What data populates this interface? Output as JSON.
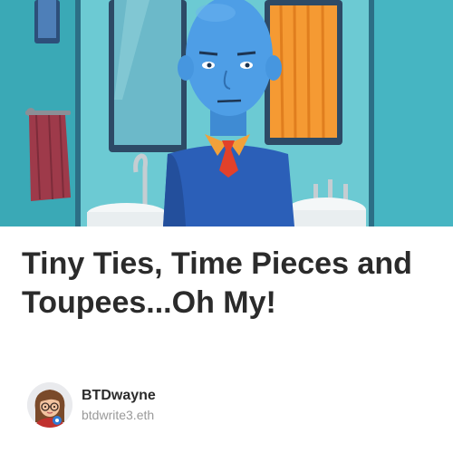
{
  "post": {
    "title": "Tiny Ties, Time Pieces and Toupees...Oh My!",
    "hero_image": "cartoon-blue-man-in-bathroom-illustration"
  },
  "author": {
    "name": "BTDwayne",
    "handle": "btdwrite3.eth",
    "avatar": "cartoon-avatar-portrait"
  },
  "colors": {
    "title_text": "#2b2b2b",
    "handle_text": "#9a9a9a",
    "background": "#ffffff",
    "hero_wall": "#48b9c6",
    "character_skin": "#4e9ee6",
    "shirt": "#2b5fb8",
    "tie": "#e2412a",
    "collar": "#f2a13a",
    "towel": "#9e3a4a",
    "curtain": "#f59a33"
  }
}
